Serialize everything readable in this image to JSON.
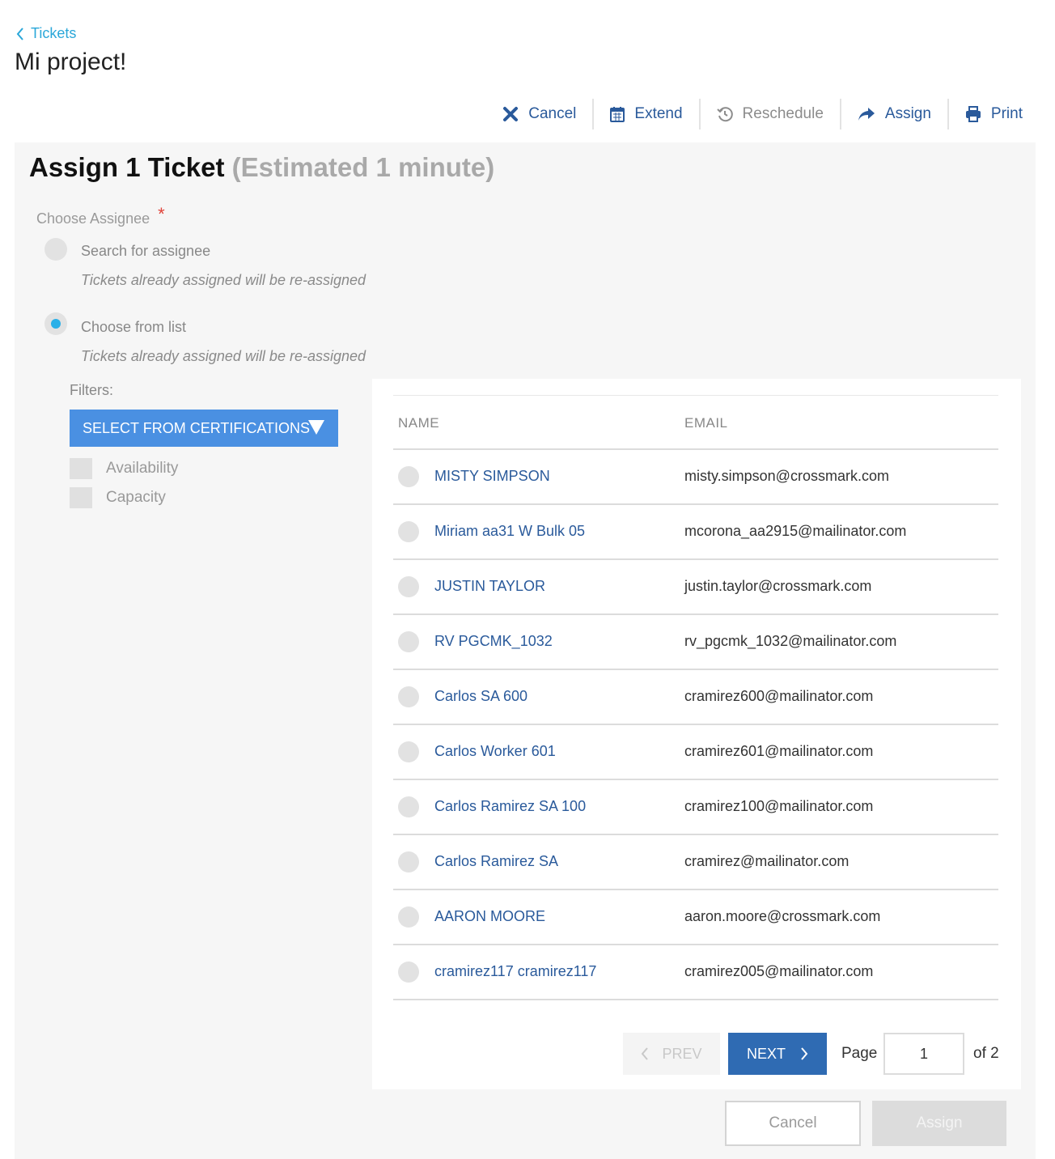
{
  "breadcrumb": {
    "label": "Tickets"
  },
  "page": {
    "title": "Mi project!"
  },
  "toolbar": {
    "cancel": "Cancel",
    "extend": "Extend",
    "reschedule": "Reschedule",
    "assign": "Assign",
    "print": "Print"
  },
  "panel": {
    "title": "Assign 1 Ticket",
    "estimate": "(Estimated 1 minute)",
    "choose_label": "Choose Assignee",
    "required_mark": "*",
    "options": [
      {
        "label": "Search for assignee",
        "hint": "Tickets already assigned will be re-assigned",
        "selected": false
      },
      {
        "label": "Choose from list",
        "hint": "Tickets already assigned will be re-assigned",
        "selected": true
      }
    ],
    "filters_label": "Filters:",
    "cert_button": "SELECT FROM CERTIFICATIONS",
    "checkboxes": [
      "Availability",
      "Capacity"
    ]
  },
  "table": {
    "columns": {
      "name": "NAME",
      "email": "EMAIL"
    },
    "rows": [
      {
        "name": "MISTY SIMPSON",
        "email": "misty.simpson@crossmark.com"
      },
      {
        "name": "Miriam aa31 W Bulk 05",
        "email": "mcorona_aa2915@mailinator.com"
      },
      {
        "name": "JUSTIN TAYLOR",
        "email": "justin.taylor@crossmark.com"
      },
      {
        "name": "RV PGCMK_1032",
        "email": "rv_pgcmk_1032@mailinator.com"
      },
      {
        "name": "Carlos SA 600",
        "email": "cramirez600@mailinator.com"
      },
      {
        "name": "Carlos Worker 601",
        "email": "cramirez601@mailinator.com"
      },
      {
        "name": "Carlos Ramirez SA 100",
        "email": "cramirez100@mailinator.com"
      },
      {
        "name": "Carlos Ramirez SA",
        "email": "cramirez@mailinator.com"
      },
      {
        "name": "AARON MOORE",
        "email": "aaron.moore@crossmark.com"
      },
      {
        "name": "cramirez117 cramirez117",
        "email": "cramirez005@mailinator.com"
      }
    ]
  },
  "pagination": {
    "prev": "PREV",
    "next": "NEXT",
    "page_label": "Page",
    "page_value": "1",
    "of_label": "of 2"
  },
  "footer": {
    "cancel": "Cancel",
    "assign": "Assign"
  },
  "colors": {
    "accent": "#4a90e2",
    "link": "#2a5a9b",
    "breadcrumb": "#2aa7d9",
    "required": "#e0433a"
  }
}
